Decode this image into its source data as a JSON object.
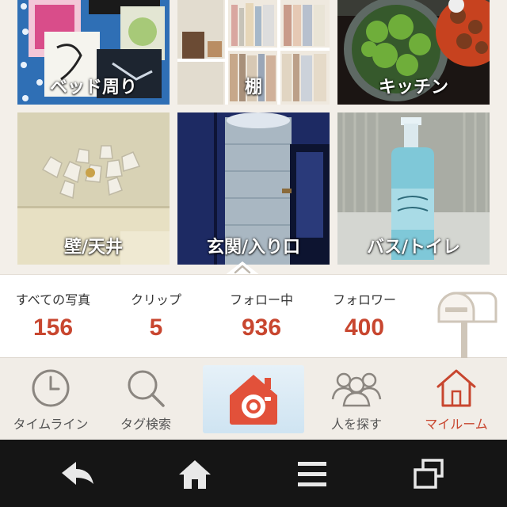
{
  "grid": {
    "tiles": [
      {
        "label": "ベッド周り",
        "icon": "bedroom-photo"
      },
      {
        "label": "棚",
        "icon": "shelf-photo"
      },
      {
        "label": "キッチン",
        "icon": "kitchen-photo"
      },
      {
        "label": "壁/天井",
        "icon": "ceiling-light-photo"
      },
      {
        "label": "玄関/入り口",
        "icon": "entrance-photo"
      },
      {
        "label": "バス/トイレ",
        "icon": "bath-bottle-photo"
      }
    ]
  },
  "stats": {
    "all_photos_label": "すべての写真",
    "all_photos_value": "156",
    "clip_label": "クリップ",
    "clip_value": "5",
    "following_label": "フォロー中",
    "following_value": "936",
    "followers_label": "フォロワー",
    "followers_value": "400"
  },
  "tabs": {
    "timeline": "タイムライン",
    "tag_search": "タグ検索",
    "find_people": "人を探す",
    "my_room": "マイルーム",
    "active": "my_room"
  },
  "colors": {
    "accent": "#c8462f",
    "camera_bg": "#d6e8f4",
    "nav_bg": "#151515"
  }
}
